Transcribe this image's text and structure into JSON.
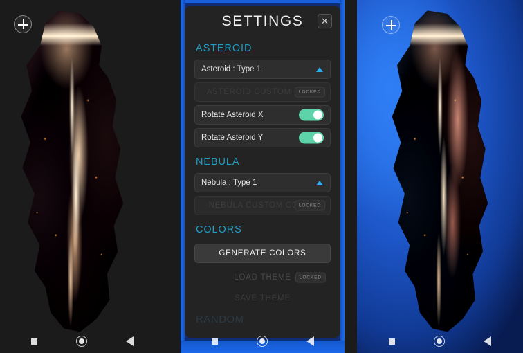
{
  "app": {
    "left_panel": {
      "add_button_icon": "plus-circle-icon",
      "nebula_theme": "pink",
      "asteroid_label": "asteroid-render"
    },
    "right_panel": {
      "add_button_icon": "plus-circle-icon",
      "nebula_theme": "blue",
      "asteroid_label": "asteroid-render"
    }
  },
  "settings": {
    "title": "SETTINGS",
    "close_label": "✕",
    "sections": [
      {
        "id": "asteroid",
        "heading": "ASTEROID",
        "rows": [
          {
            "type": "dropdown",
            "label": "Asteroid : Type 1",
            "arrow_icon": "triangle-up-icon"
          },
          {
            "type": "locked",
            "label": "ASTEROID CUSTOM COLO",
            "badge": "LOCKED"
          },
          {
            "type": "toggle",
            "label": "Rotate Asteroid X",
            "state": "on"
          },
          {
            "type": "toggle",
            "label": "Rotate Asteroid Y",
            "state": "on"
          }
        ]
      },
      {
        "id": "nebula",
        "heading": "NEBULA",
        "rows": [
          {
            "type": "dropdown",
            "label": "Nebula : Type 1",
            "arrow_icon": "triangle-up-icon"
          },
          {
            "type": "locked",
            "label": "NEBULA CUSTOM COLOR",
            "badge": "LOCKED"
          }
        ]
      },
      {
        "id": "colors",
        "heading": "COLORS",
        "rows": [
          {
            "type": "button",
            "label": "GENERATE COLORS"
          },
          {
            "type": "ghost-locked",
            "label": "LOAD THEME",
            "badge": "LOCKED"
          },
          {
            "type": "ghost",
            "label": "SAVE THEME"
          }
        ]
      },
      {
        "id": "random",
        "heading": "RANDOM",
        "rows": []
      }
    ]
  },
  "navbar": {
    "recents_icon": "square-icon",
    "home_icon": "circle-icon",
    "back_icon": "triangle-left-icon"
  },
  "colors": {
    "accent_cyan": "#1f9ec4",
    "toggle_on": "#5ed2a9",
    "dropdown_arrow": "#2bb0ee",
    "panel_bg": "#232323",
    "frame_blue": "#1e6ef0",
    "nebula_pink": "#c464bb",
    "nebula_blue": "#1d56c8"
  }
}
